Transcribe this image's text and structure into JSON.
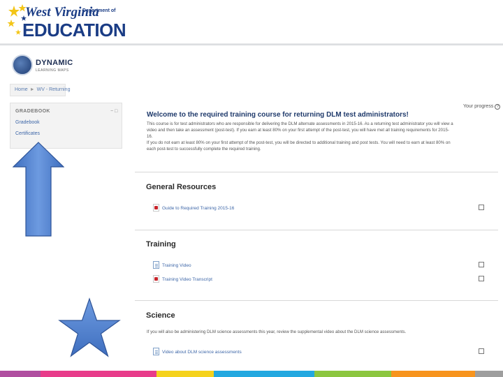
{
  "header": {
    "logo_top": "West Virginia",
    "logo_dept": "Department of",
    "logo_main": "EDUCATION"
  },
  "dlm_logo": {
    "name": "DYNAMIC",
    "sub": "LEARNING MAPS"
  },
  "breadcrumb": {
    "items": [
      "Home",
      "WV - Returning"
    ],
    "separator": "►"
  },
  "gradebook": {
    "heading": "GRADEBOOK",
    "controls": "− □",
    "links": [
      "Gradebook",
      "Certificates"
    ]
  },
  "main": {
    "progress_label": "Your progress",
    "progress_icon": "?",
    "welcome_title": "Welcome to the required training course for returning DLM test administrators!",
    "welcome_p1": "This course is for test administrators who are responsible for delivering the DLM alternate assessments in 2015-16. As a returning test administrator you will view a video and then take an assessment (post-test). If you earn at least 80% on your first attempt of the post-test, you will have met all training requirements for 2015-16.",
    "welcome_p2": "If you do not earn at least 80% on your first attempt of the post-test, you will be directed to additional training and post tests. You will need to earn at least 80% on each post-test to successfully complete the required training.",
    "sections": [
      {
        "title": "General Resources",
        "note": "",
        "items": [
          {
            "label": "Guide to Required Training 2015-16",
            "icon": "pdf-icon"
          }
        ]
      },
      {
        "title": "Training",
        "note": "",
        "items": [
          {
            "label": "Training Video",
            "icon": "document-icon"
          },
          {
            "label": "Training Video Transcript",
            "icon": "pdf-icon"
          }
        ]
      },
      {
        "title": "Science",
        "note": "If you will also be administering DLM science assessments this year, review the supplemental video about the DLM science assessments.",
        "items": [
          {
            "label": "Video about DLM science assessments",
            "icon": "document-icon"
          }
        ]
      }
    ]
  },
  "colors": {
    "brand_blue": "#1a3c85",
    "link_blue": "#3e67a8",
    "shape_blue": "#4f7fc8",
    "bar": [
      "#b04fa0",
      "#e83c8a",
      "#f5d21c",
      "#23a8e0",
      "#8cc63f",
      "#f7941d",
      "#9e9e9e"
    ]
  }
}
